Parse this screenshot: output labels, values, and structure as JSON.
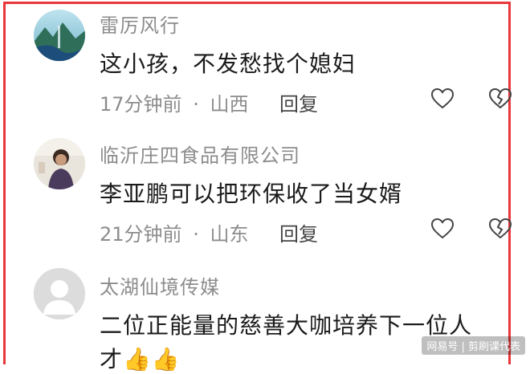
{
  "comments": [
    {
      "username": "雷厉风行",
      "text": "这小孩，不发愁找个媳妇",
      "time": "17分钟前",
      "location": "山西",
      "reply_label": "回复",
      "avatar": "landscape-avatar"
    },
    {
      "username": "临沂庄四食品有限公司",
      "text": "李亚鹏可以把环保收了当女婿",
      "time": "21分钟前",
      "location": "山东",
      "reply_label": "回复",
      "avatar": "person-photo-avatar"
    },
    {
      "username": "太湖仙境传媒",
      "text": "二位正能量的慈善大咖培养下一位人",
      "text_line2": "才👍👍",
      "avatar": "default-avatar"
    }
  ],
  "separator": "·",
  "watermark": "网易号 | 剪刷课代表",
  "colors": {
    "frame": "#e8363b",
    "username": "#8c8c8c",
    "body_text": "#1a1a1a"
  },
  "icons": [
    "heart-outline-icon",
    "broken-heart-icon"
  ]
}
